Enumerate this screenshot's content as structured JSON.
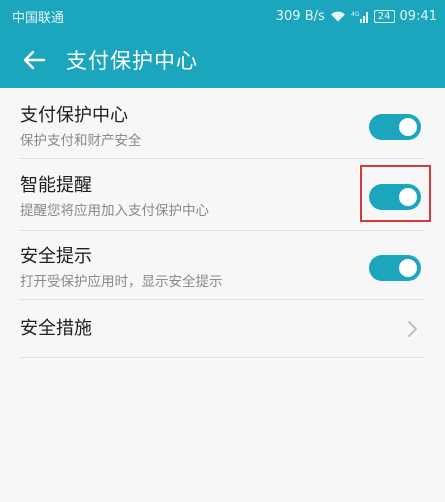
{
  "status_bar": {
    "carrier": "中国联通",
    "speed": "309 B/s",
    "signal_label": "4G",
    "battery": "24",
    "time": "09:41",
    "icons": [
      "wifi-icon",
      "signal-icon",
      "battery-icon"
    ]
  },
  "app_bar": {
    "title": "支付保护中心",
    "back_icon": "arrow-left-icon"
  },
  "settings": {
    "items": [
      {
        "title": "支付保护中心",
        "subtitle": "保护支付和财产安全",
        "toggle": true
      },
      {
        "title": "智能提醒",
        "subtitle": "提醒您将应用加入支付保护中心",
        "toggle": true,
        "highlighted": true
      },
      {
        "title": "安全提示",
        "subtitle": "打开受保护应用时，显示安全提示",
        "toggle": true
      },
      {
        "title": "安全措施",
        "type": "link"
      }
    ]
  },
  "colors": {
    "accent": "#1ba6bd",
    "highlight": "#d63b3b",
    "background": "#f7f7f7"
  }
}
